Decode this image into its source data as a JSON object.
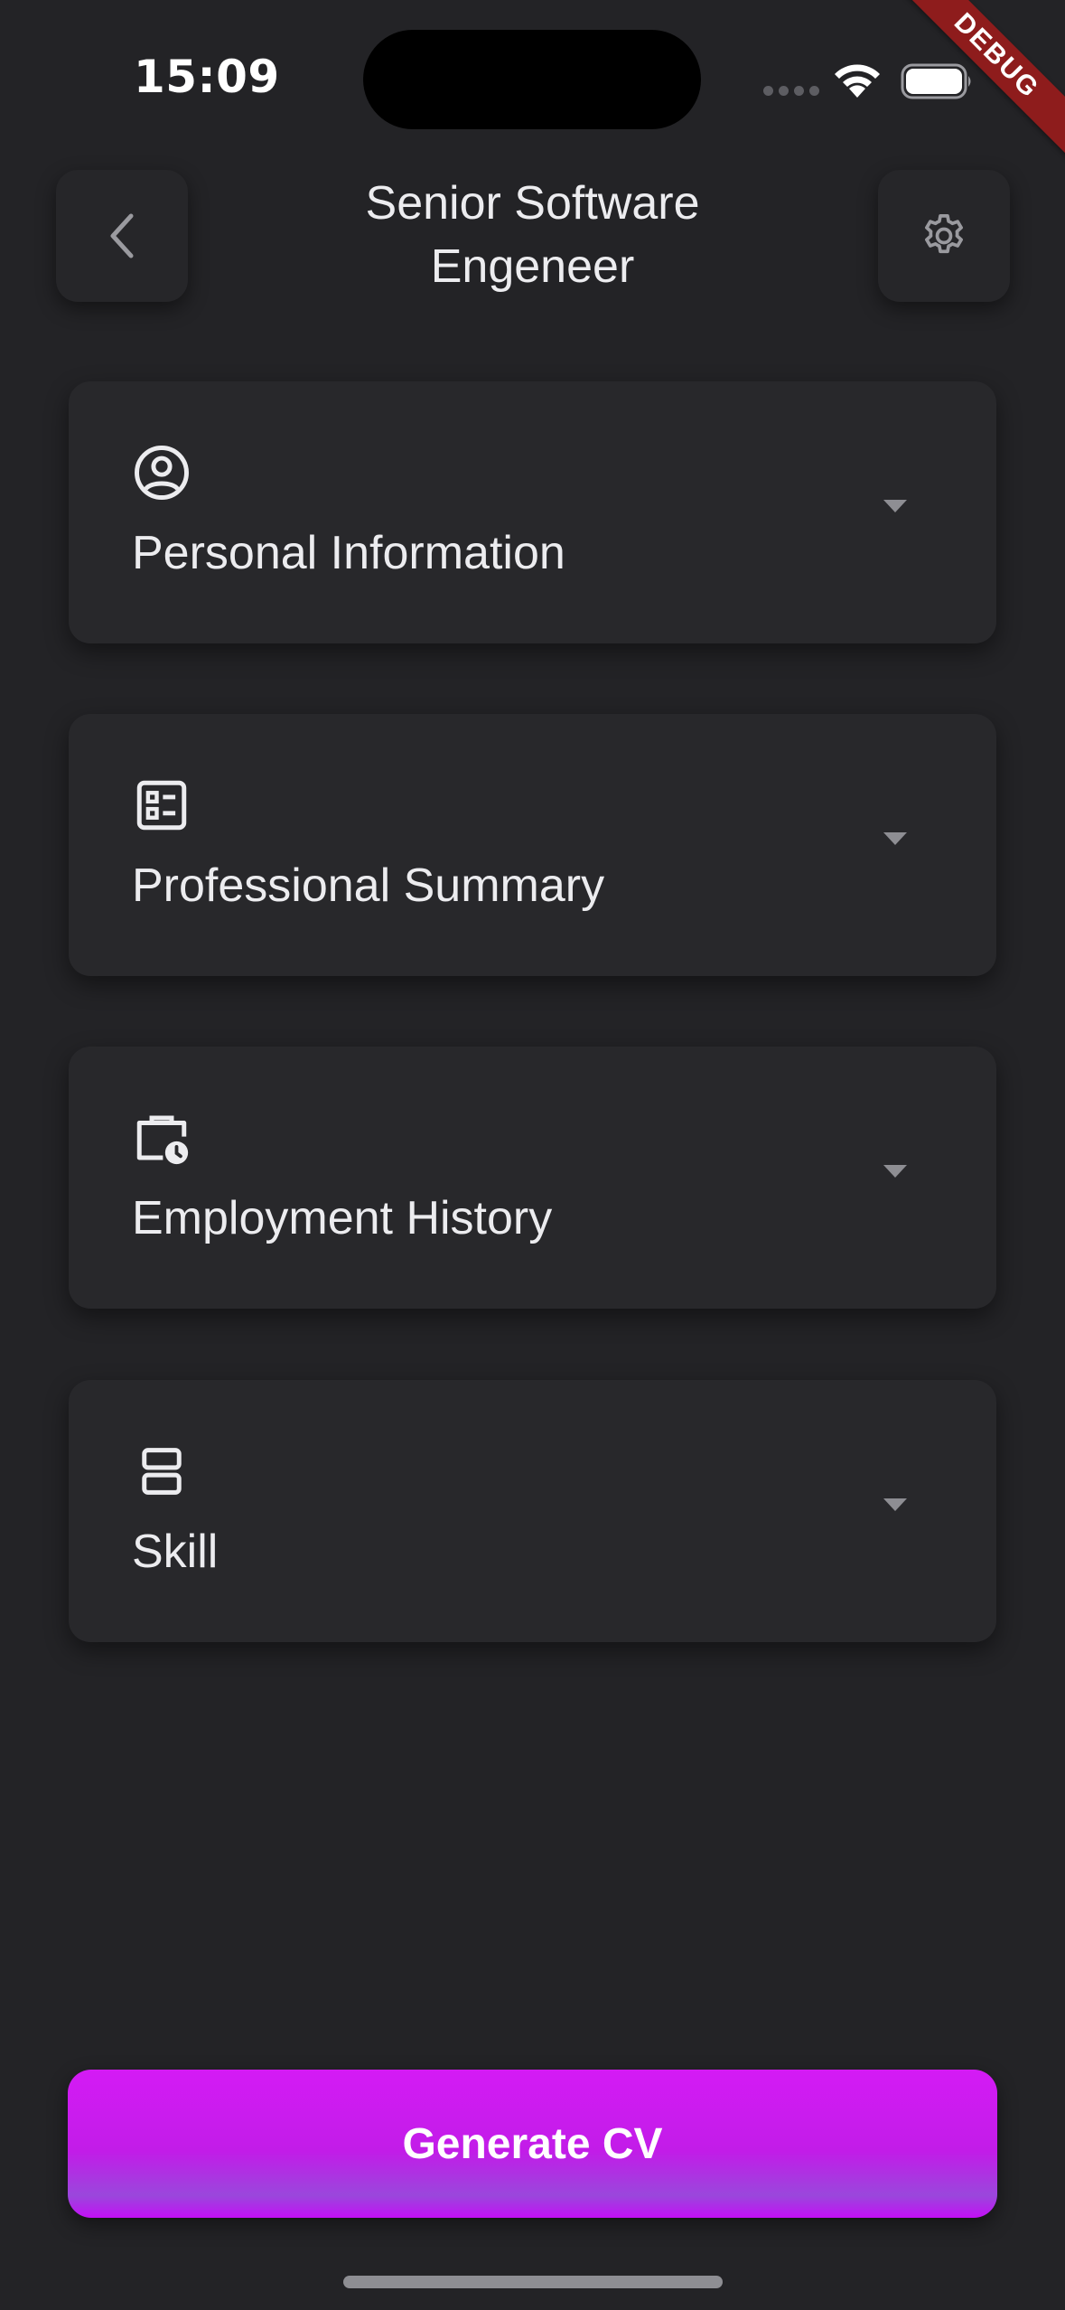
{
  "status_bar": {
    "time": "15:09",
    "debug_label": "DEBUG"
  },
  "header": {
    "title": "Senior Software Engeneer",
    "back_icon": "chevron-left-icon",
    "settings_icon": "gear-icon"
  },
  "sections": [
    {
      "label": "Personal Information",
      "icon": "account-circle-icon"
    },
    {
      "label": "Professional Summary",
      "icon": "list-alt-icon"
    },
    {
      "label": "Employment History",
      "icon": "work-history-icon"
    },
    {
      "label": "Skill",
      "icon": "view-agenda-icon"
    }
  ],
  "footer": {
    "generate_label": "Generate CV"
  },
  "colors": {
    "background": "#232326",
    "card": "#28282b",
    "accent": "#c21ce8",
    "debug_ribbon": "#8e1c1c"
  }
}
